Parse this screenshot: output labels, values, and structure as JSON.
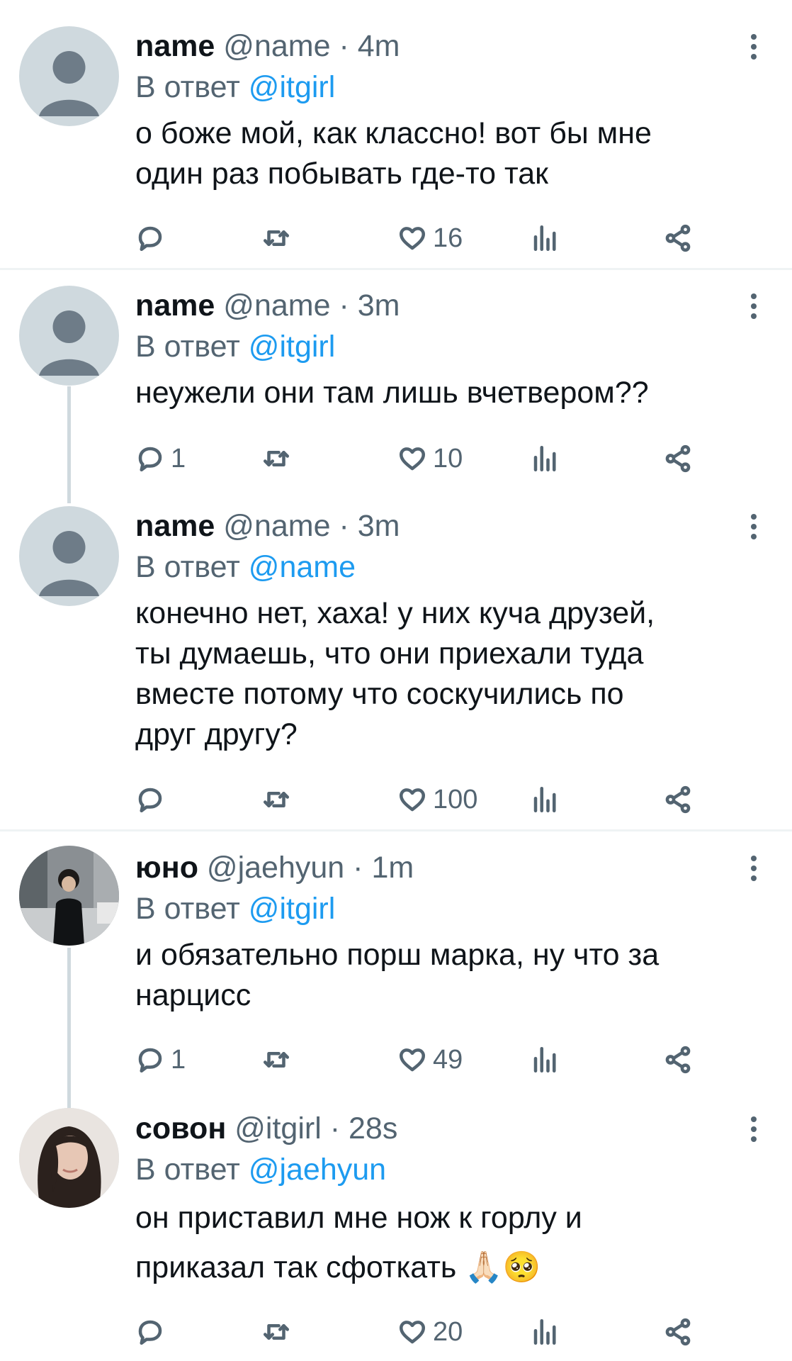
{
  "tweets": [
    {
      "name": "name",
      "handle": "@name",
      "time": "4m",
      "reply_prefix": "В ответ",
      "reply_to": "@itgirl",
      "lines": [
        "о боже мой, как классно! вот бы мне",
        "один раз побывать где-то так"
      ],
      "replies": "",
      "retweets": "",
      "likes": "16"
    },
    {
      "name": "name",
      "handle": "@name",
      "time": "3m",
      "reply_prefix": "В ответ",
      "reply_to": "@itgirl",
      "lines": [
        "неужели они там лишь вчетвером??"
      ],
      "replies": "1",
      "retweets": "",
      "likes": "10"
    },
    {
      "name": "name",
      "handle": "@name",
      "time": "3m",
      "reply_prefix": "В ответ",
      "reply_to": "@name",
      "lines": [
        "конечно нет, хаха! у них куча друзей,",
        "ты думаешь, что они приехали туда",
        "вместе потому что соскучились по",
        "друг другу?"
      ],
      "replies": "",
      "retweets": "",
      "likes": "100"
    },
    {
      "name": "юно",
      "handle": "@jaehyun",
      "time": "1m",
      "reply_prefix": "В ответ",
      "reply_to": "@itgirl",
      "lines": [
        "и обязательно порш марка, ну что за",
        "нарцисс"
      ],
      "replies": "1",
      "retweets": "",
      "likes": "49"
    },
    {
      "name": "совон",
      "handle": "@itgirl",
      "time": "28s",
      "reply_prefix": "В ответ",
      "reply_to": "@jaehyun",
      "lines": [
        "он приставил мне нож к горлу и",
        "приказал так сфоткать 🙏🏻🥺"
      ],
      "replies": "",
      "retweets": "",
      "likes": "20"
    }
  ],
  "separator": "·",
  "icons": {
    "reply": "reply-icon",
    "retweet": "retweet-icon",
    "like": "heart-icon",
    "views": "bar-chart-icon",
    "share": "share-icon",
    "menu": "more-vertical-icon"
  },
  "colors": {
    "mention": "#1d9bf0",
    "muted": "#536471",
    "avatar_placeholder": "#cfd9de"
  }
}
